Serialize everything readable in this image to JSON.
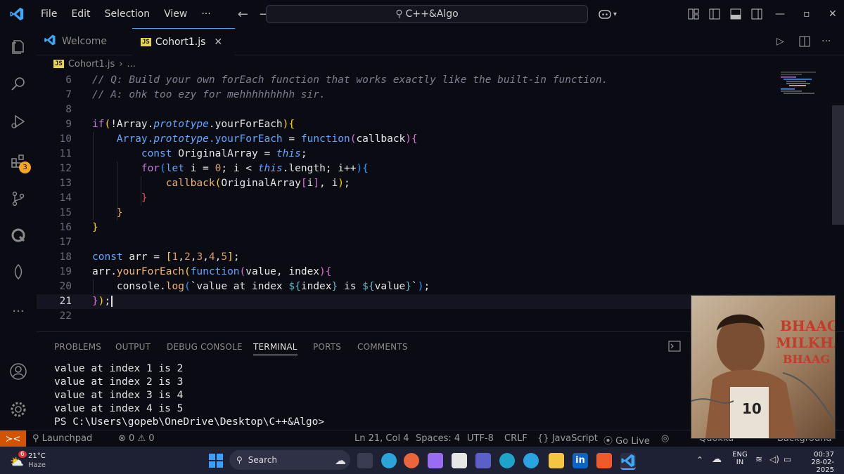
{
  "titlebar": {
    "menus": [
      "File",
      "Edit",
      "Selection",
      "View",
      "···"
    ],
    "command_center": "C++&Algo"
  },
  "activity": {
    "extensions_badge": "3"
  },
  "tabs": [
    {
      "label": "Welcome"
    },
    {
      "label": "Cohort1.js",
      "icon_text": "JS"
    }
  ],
  "breadcrumb": {
    "file": "Cohort1.js",
    "sep": "›",
    "more": "..."
  },
  "editor": {
    "line_numbers": [
      "6",
      "7",
      "8",
      "9",
      "10",
      "11",
      "12",
      "13",
      "14",
      "15",
      "16",
      "17",
      "18",
      "19",
      "20",
      "21",
      "22"
    ]
  },
  "panel": {
    "tabs": [
      "PROBLEMS",
      "OUTPUT",
      "DEBUG CONSOLE",
      "TERMINAL",
      "PORTS",
      "COMMENTS"
    ],
    "active_tab": "TERMINAL",
    "terminal_lines": [
      "value at index 1 is 2",
      "value at index 2 is 3",
      "value at index 3 is 4",
      "value at index 4 is 5",
      "PS C:\\Users\\gopeb\\OneDrive\\Desktop\\C++&Algo>"
    ]
  },
  "statusbar": {
    "launchpad": "Launchpad",
    "errors": "0",
    "warnings": "0",
    "position": "Ln 21, Col 4",
    "spaces": "Spaces: 4",
    "encoding": "UTF-8",
    "eol": "CRLF",
    "language": "JavaScript",
    "golive": "Go Live",
    "quokka": "Quokka",
    "background": "Background"
  },
  "taskbar": {
    "weather_temp": "21°C",
    "weather_desc": "Haze",
    "weather_badge": "6",
    "search_label": "Search",
    "lang_top": "ENG",
    "lang_bottom": "IN",
    "time": "00:37",
    "date": "28-02-2025"
  },
  "poster": {
    "title_lines": [
      "BHAAG",
      "MILKHA",
      "BHAAG"
    ],
    "bib": "10"
  },
  "colors": {
    "accent_orange": "#d35400",
    "background": "#0b0b14",
    "badge": "#f5a623"
  }
}
